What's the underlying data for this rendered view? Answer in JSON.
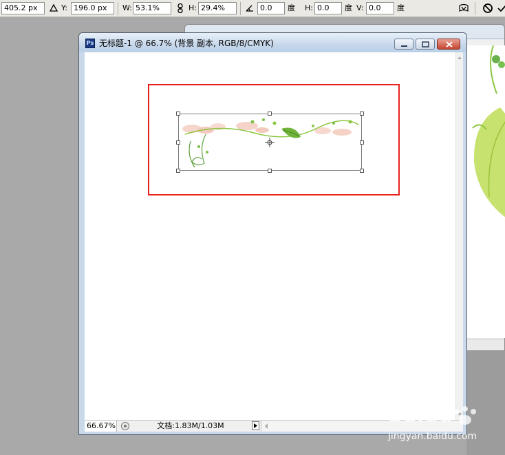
{
  "options_bar": {
    "x_value": "405.2 px",
    "delta_icon": "triangle-icon",
    "y_label": "Y:",
    "y_value": "196.0 px",
    "w_label": "W:",
    "w_value": "53.1%",
    "link_icon": "link-icon",
    "h_label": "H:",
    "h_value": "29.4%",
    "angle_icon": "angle-icon",
    "rotate_value": "0.0",
    "rotate_unit": "度",
    "skew_h_label": "H:",
    "skew_h_value": "0.0",
    "skew_h_unit": "度",
    "skew_v_label": "V:",
    "skew_v_value": "0.0",
    "skew_v_unit": "度",
    "warp_icon": "warp-icon",
    "cancel_icon": "cancel-icon",
    "commit_icon": "commit-check-icon"
  },
  "document": {
    "title": "无标题-1 @ 66.7% (背景 副本, RGB/8/CMYK)",
    "app_icon_text": "Ps",
    "zoom": "66.67%",
    "doc_info": "文档:1.83M/1.03M"
  },
  "colors": {
    "selection_box": "#e8211c",
    "titlebar": "#c7d8eb",
    "workspace": "#a9a9a9"
  },
  "watermark": {
    "url": "jingyan.baidu.com"
  }
}
